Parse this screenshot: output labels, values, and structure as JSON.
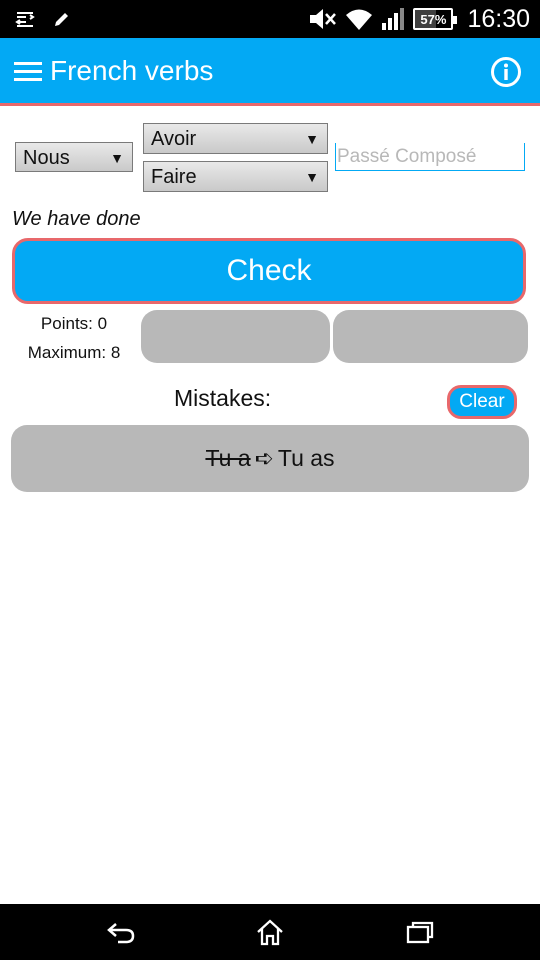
{
  "status_bar": {
    "battery_percent": "57%",
    "battery_level": 0.57,
    "time": "16:30",
    "icons": [
      "data-transfer-icon",
      "pencil-icon",
      "mute-icon",
      "wifi-icon",
      "signal-icon",
      "battery-icon"
    ]
  },
  "app_bar": {
    "title": "French verbs",
    "menu_icon": "hamburger-menu-icon",
    "info_icon": "info-icon",
    "color": "#03a9f4",
    "accent": "#e8686b"
  },
  "form": {
    "pronoun": "Nous",
    "verb1": "Avoir",
    "verb2": "Faire",
    "answer_placeholder": "Passé Composé",
    "answer_value": ""
  },
  "translation": "We have done",
  "check_label": "Check",
  "score": {
    "points": "Points: 0",
    "maximum": "Maximum: 8"
  },
  "mistakes": {
    "label": "Mistakes:",
    "clear_label": "Clear",
    "items": [
      {
        "wrong": "Tu a",
        "arrow": "➪",
        "correct": "Tu as"
      }
    ]
  },
  "nav_bar": {
    "icons": [
      "back-icon",
      "home-icon",
      "recents-icon"
    ]
  }
}
